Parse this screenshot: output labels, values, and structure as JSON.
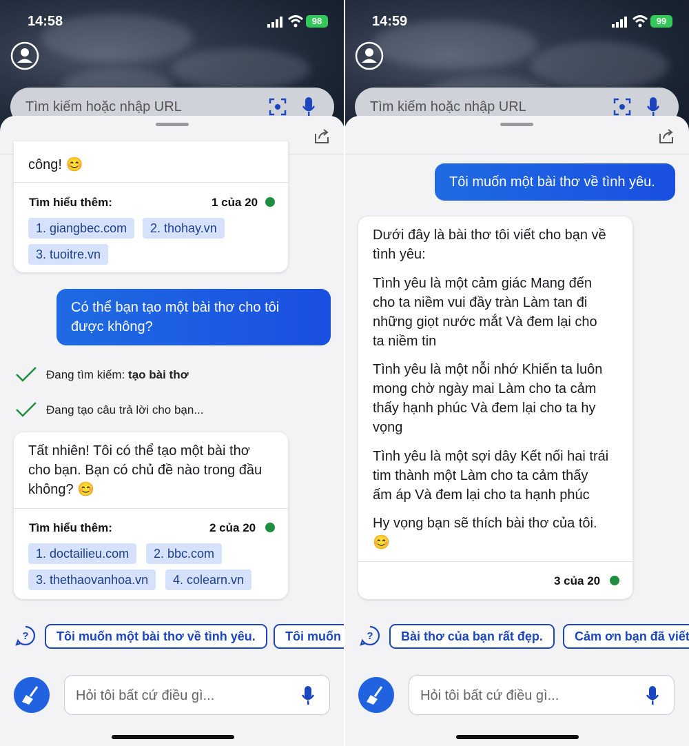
{
  "status_left": {
    "time": "14:58",
    "battery": "98"
  },
  "status_right": {
    "time": "14:59",
    "battery": "99"
  },
  "search": {
    "placeholder": "Tìm kiếm hoặc nhập URL"
  },
  "ask": {
    "placeholder": "Hỏi tôi bất cứ điều gì..."
  },
  "left": {
    "card1": {
      "text": "công! 😊",
      "learn_label": "Tìm hiểu thêm:",
      "count": "1 của 20",
      "links": [
        "1. giangbec.com",
        "2. thohay.vn",
        "3. tuoitre.vn"
      ]
    },
    "user_message": [
      "Có thể bạn tạo một bài thơ cho tôi",
      "được không?"
    ],
    "steps": {
      "searching_prefix": "Đang tìm kiếm: ",
      "searching_query": "tạo bài thơ",
      "generating": "Đang tạo câu trả lời cho bạn..."
    },
    "card2": {
      "lines": [
        "Tất nhiên! Tôi có thể tạo một bài thơ",
        "cho bạn. Bạn có chủ đề nào trong đầu",
        "không? 😊"
      ],
      "learn_label": "Tìm hiểu thêm:",
      "count": "2 của 20",
      "links": [
        "1. doctailieu.com",
        "2. bbc.com",
        "3. thethaovanhoa.vn",
        "4. colearn.vn"
      ]
    },
    "suggestions": [
      "Tôi muốn một bài thơ về tình yêu.",
      "Tôi muốn m"
    ]
  },
  "right": {
    "user_message": "Tôi muốn một bài thơ về tình yêu.",
    "answer": {
      "intro": [
        "Dưới đây là bài thơ tôi viết cho bạn về",
        "tình yêu:"
      ],
      "stanza1": [
        "Tình yêu là một cảm giác Mang đến",
        "cho ta niềm vui đầy tràn Làm tan đi",
        "những giọt nước mắt Và đem lại cho",
        "ta niềm tin"
      ],
      "stanza2": [
        "Tình yêu là một nỗi nhớ Khiến ta luôn",
        "mong chờ ngày mai Làm cho ta cảm",
        "thấy hạnh phúc Và đem lại cho ta hy",
        "vọng"
      ],
      "stanza3": [
        "Tình yêu là một sợi dây Kết nối hai trái",
        "tim thành một Làm cho ta cảm thấy",
        "ấm áp Và đem lại cho ta hạnh phúc"
      ],
      "closing": [
        "Hy vọng bạn sẽ thích bài thơ của tôi.",
        "😊"
      ],
      "count": "3 của 20"
    },
    "suggestions": [
      "Bài thơ của bạn rất đẹp.",
      "Cảm ơn bạn đã viết"
    ]
  },
  "colors": {
    "accent": "#1f6be3",
    "chip_bg": "#d6e2fb",
    "chip_text": "#1f3f8f",
    "status_dot": "#1e8e3e",
    "battery": "#34c759"
  }
}
